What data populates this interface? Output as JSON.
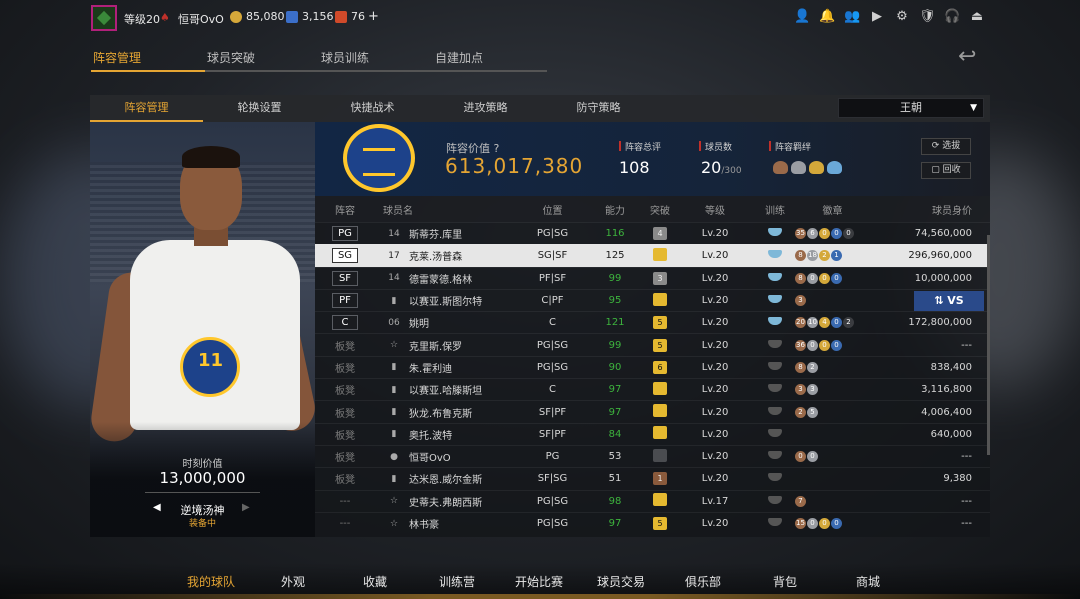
{
  "header": {
    "level": "等级20",
    "username": "恒哥OvO",
    "gold": "85,080",
    "points": "3,156",
    "tokens": "76",
    "plus": "+"
  },
  "tabs_primary": [
    "阵容管理",
    "球员突破",
    "球员训练",
    "自建加点"
  ],
  "tabs_secondary": [
    "阵容管理",
    "轮换设置",
    "快捷战术",
    "进攻策略",
    "防守策略"
  ],
  "dynasty_select": "王朝",
  "team": {
    "value_label": "阵容价值",
    "value": "613,017,380",
    "rating_label": "阵容总评",
    "rating": "108",
    "count_label": "球员数",
    "count": "20",
    "count_max": "/300",
    "bond_label": "阵容羁绊",
    "select_btn": "选拔",
    "recycle_btn": "回收"
  },
  "card": {
    "value_label": "时刻价值",
    "value": "13,000,000",
    "skin_name": "逆境汤神",
    "skin_status": "装备中"
  },
  "columns": [
    "阵容",
    "球员名",
    "位置",
    "能力",
    "突破",
    "等级",
    "训练",
    "徽章",
    "球员身价"
  ],
  "players": [
    {
      "pos": "PG",
      "num": "14",
      "name": "斯蒂芬.库里",
      "role": "PG|SG",
      "ovr": "116",
      "brk": "4",
      "lvl": "Lv.20",
      "badges": [
        "35",
        "6",
        "0",
        "0",
        "0"
      ],
      "salary": "74,560,000"
    },
    {
      "pos": "SG",
      "num": "17",
      "name": "克莱.汤普森",
      "role": "SG|SF",
      "ovr": "125",
      "brk": "",
      "lvl": "Lv.20",
      "badges": [
        "8",
        "18",
        "2",
        "1"
      ],
      "salary": "296,960,000"
    },
    {
      "pos": "SF",
      "num": "14",
      "name": "德雷蒙德.格林",
      "role": "PF|SF",
      "ovr": "99",
      "brk": "3",
      "lvl": "Lv.20",
      "badges": [
        "8",
        "0",
        "0",
        "0"
      ],
      "salary": "10,000,000"
    },
    {
      "pos": "PF",
      "num": "",
      "name": "以赛亚.斯图尔特",
      "role": "C|PF",
      "ovr": "95",
      "brk": "",
      "lvl": "Lv.20",
      "badges": [
        "3"
      ],
      "salary": "",
      "vs": "VS"
    },
    {
      "pos": "C",
      "num": "06",
      "name": "姚明",
      "role": "C",
      "ovr": "121",
      "brk": "5",
      "lvl": "Lv.20",
      "badges": [
        "20",
        "10",
        "4",
        "0",
        "2"
      ],
      "salary": "172,800,000"
    },
    {
      "pos": "板凳",
      "num": "",
      "name": "克里斯.保罗",
      "role": "PG|SG",
      "ovr": "99",
      "brk": "5",
      "lvl": "Lv.20",
      "badges": [
        "36",
        "0",
        "0",
        "0"
      ],
      "salary": "---"
    },
    {
      "pos": "板凳",
      "num": "",
      "name": "朱.霍利迪",
      "role": "PG|SG",
      "ovr": "90",
      "brk": "6",
      "lvl": "Lv.20",
      "badges": [
        "8",
        "2"
      ],
      "salary": "838,400"
    },
    {
      "pos": "板凳",
      "num": "",
      "name": "以赛亚.哈滕斯坦",
      "role": "C",
      "ovr": "97",
      "brk": "",
      "lvl": "Lv.20",
      "badges": [
        "3",
        "3"
      ],
      "salary": "3,116,800"
    },
    {
      "pos": "板凳",
      "num": "",
      "name": "狄龙.布鲁克斯",
      "role": "SF|PF",
      "ovr": "97",
      "brk": "",
      "lvl": "Lv.20",
      "badges": [
        "2",
        "5"
      ],
      "salary": "4,006,400"
    },
    {
      "pos": "板凳",
      "num": "",
      "name": "奥托.波特",
      "role": "SF|PF",
      "ovr": "84",
      "brk": "",
      "lvl": "Lv.20",
      "badges": [],
      "salary": "640,000"
    },
    {
      "pos": "板凳",
      "num": "",
      "name": "恒哥OvO",
      "role": "PG",
      "ovr": "53",
      "brk": "",
      "lvl": "Lv.20",
      "badges": [
        "0",
        "0"
      ],
      "salary": "---"
    },
    {
      "pos": "板凳",
      "num": "",
      "name": "达米恩.威尔金斯",
      "role": "SF|SG",
      "ovr": "51",
      "brk": "1",
      "lvl": "Lv.20",
      "badges": [],
      "salary": "9,380"
    },
    {
      "pos": "---",
      "num": "",
      "name": "史蒂夫.弗朗西斯",
      "role": "PG|SG",
      "ovr": "98",
      "brk": "",
      "lvl": "Lv.17",
      "badges": [
        "7"
      ],
      "salary": "---"
    },
    {
      "pos": "---",
      "num": "",
      "name": "林书豪",
      "role": "PG|SG",
      "ovr": "97",
      "brk": "5",
      "lvl": "Lv.20",
      "badges": [
        "15",
        "0",
        "0",
        "0"
      ],
      "salary": "---"
    }
  ],
  "bottom_nav": [
    "我的球队",
    "外观",
    "收藏",
    "训练营",
    "开始比赛",
    "球员交易",
    "俱乐部",
    "背包",
    "商城"
  ]
}
